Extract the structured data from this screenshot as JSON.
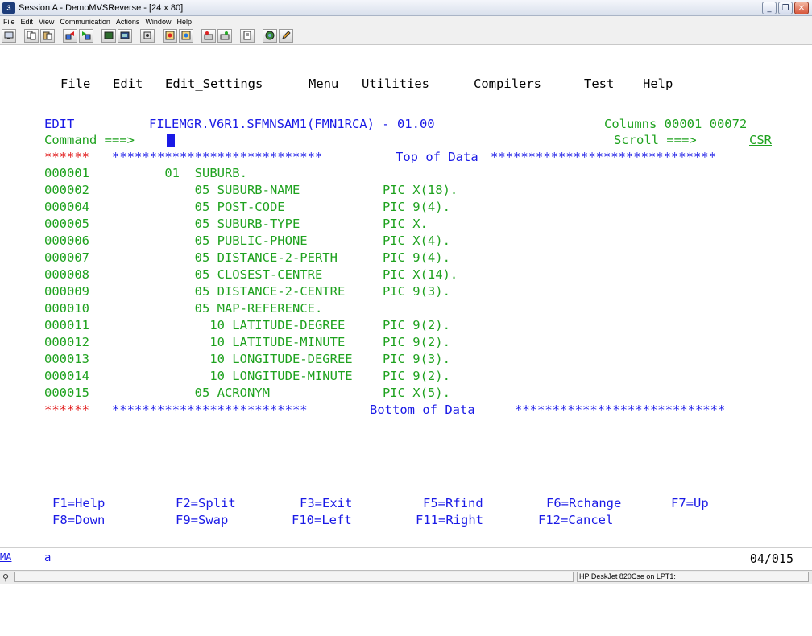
{
  "window": {
    "icon_text": "3",
    "title": "Session A - DemoMVSReverse - [24 x 80]",
    "buttons": {
      "minimize": "_",
      "restore": "❐",
      "close": "✕"
    }
  },
  "menubar": [
    "File",
    "Edit",
    "View",
    "Communication",
    "Actions",
    "Window",
    "Help"
  ],
  "toolbar_icons": [
    "print-screen-icon",
    "copy-icon",
    "paste-icon",
    "send-file-icon",
    "receive-file-icon",
    "display-icon",
    "keypad-icon",
    "macro-record-icon",
    "macro-play-icon",
    "macro-stop-icon",
    "run-icon",
    "stop-run-icon",
    "clipboard-icon",
    "color-palette-icon",
    "edit-pencil-icon"
  ],
  "colors": {
    "blue": "#1a1ae6",
    "green": "#1fa21f",
    "red": "#e01414",
    "black": "#000000"
  },
  "ispf": {
    "action_bar": [
      {
        "hot": "F",
        "rest": "ile"
      },
      {
        "hot": "E",
        "rest": "dit"
      },
      {
        "pre": "E",
        "hot": "d",
        "rest": "it_Settings"
      },
      {
        "hot": "M",
        "rest": "enu"
      },
      {
        "hot": "U",
        "rest": "tilities"
      },
      {
        "hot": "C",
        "rest": "ompilers"
      },
      {
        "hot": "T",
        "rest": "est"
      },
      {
        "hot": "H",
        "rest": "elp"
      }
    ],
    "mode": "EDIT",
    "dataset": "FILEMGR.V6R1.SFMNSAM1(FMN1RCA) - 01.00",
    "columns": "Columns 00001 00072",
    "command_label": "Command ===>",
    "scroll_label": "Scroll ===>",
    "scroll_value": "CSR",
    "top_marker": "******",
    "top_stars_left": "****************************",
    "top_of_data": "Top of Data",
    "top_stars_right": "******************************",
    "bottom_marker": "******",
    "bottom_stars_left": "**************************",
    "bottom_of_data": "Bottom of Data",
    "bottom_stars_right": "****************************",
    "lines": [
      {
        "num": "000001",
        "text": "       01  SUBURB."
      },
      {
        "num": "000002",
        "text": "           05 SUBURB-NAME           PIC X(18)."
      },
      {
        "num": "000004",
        "text": "           05 POST-CODE             PIC 9(4)."
      },
      {
        "num": "000005",
        "text": "           05 SUBURB-TYPE           PIC X."
      },
      {
        "num": "000006",
        "text": "           05 PUBLIC-PHONE          PIC X(4)."
      },
      {
        "num": "000007",
        "text": "           05 DISTANCE-2-PERTH      PIC 9(4)."
      },
      {
        "num": "000008",
        "text": "           05 CLOSEST-CENTRE        PIC X(14)."
      },
      {
        "num": "000009",
        "text": "           05 DISTANCE-2-CENTRE     PIC 9(3)."
      },
      {
        "num": "000010",
        "text": "           05 MAP-REFERENCE."
      },
      {
        "num": "000011",
        "text": "             10 LATITUDE-DEGREE     PIC 9(2)."
      },
      {
        "num": "000012",
        "text": "             10 LATITUDE-MINUTE     PIC 9(2)."
      },
      {
        "num": "000013",
        "text": "             10 LONGITUDE-DEGREE    PIC 9(3)."
      },
      {
        "num": "000014",
        "text": "             10 LONGITUDE-MINUTE    PIC 9(2)."
      },
      {
        "num": "000015",
        "text": "           05 ACRONYM               PIC X(5)."
      }
    ],
    "pfkeys_row1": [
      "F1=Help",
      "F2=Split",
      "F3=Exit",
      "F5=Rfind",
      "F6=Rchange",
      "F7=Up"
    ],
    "pfkeys_row2": [
      "F8=Down",
      "F9=Swap",
      "F10=Left",
      "F11=Right",
      "F12=Cancel"
    ]
  },
  "oia": {
    "ma": "MA",
    "mode": "a",
    "cursor_pos": "04/015"
  },
  "statusbar": {
    "printer": "HP DeskJet 820Cse on LPT1:"
  }
}
